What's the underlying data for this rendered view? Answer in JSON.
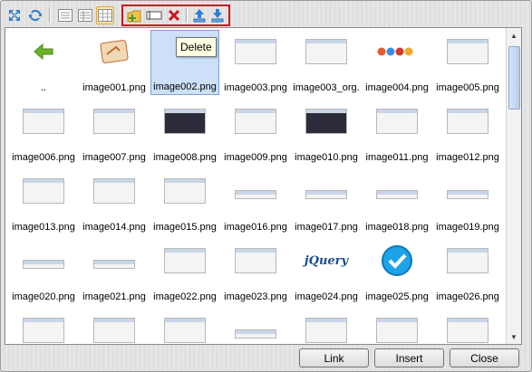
{
  "tooltip": "Delete",
  "buttons": {
    "link": "Link",
    "insert": "Insert",
    "close": "Close"
  },
  "toolbar": {
    "tools": [
      {
        "name": "expand-icon"
      },
      {
        "name": "refresh-icon"
      },
      {
        "name": "view-list-icon"
      },
      {
        "name": "view-details-icon"
      },
      {
        "name": "view-thumbnails-icon",
        "active": true
      },
      {
        "name": "new-folder-icon"
      },
      {
        "name": "rename-icon"
      },
      {
        "name": "delete-icon"
      },
      {
        "name": "upload-icon"
      },
      {
        "name": "download-icon"
      }
    ]
  },
  "files": [
    {
      "label": "..",
      "kind": "up"
    },
    {
      "label": "image001.png",
      "kind": "app"
    },
    {
      "label": "image002.png",
      "kind": "blank",
      "selected": true
    },
    {
      "label": "image003.png",
      "kind": "shot"
    },
    {
      "label": "image003_org.",
      "kind": "shot"
    },
    {
      "label": "image004.png",
      "kind": "browsers"
    },
    {
      "label": "image005.png",
      "kind": "shot"
    },
    {
      "label": "image006.png",
      "kind": "shot"
    },
    {
      "label": "image007.png",
      "kind": "shot"
    },
    {
      "label": "image008.png",
      "kind": "dark"
    },
    {
      "label": "image009.png",
      "kind": "shot"
    },
    {
      "label": "image010.png",
      "kind": "dark"
    },
    {
      "label": "image011.png",
      "kind": "shot"
    },
    {
      "label": "image012.png",
      "kind": "shot"
    },
    {
      "label": "image013.png",
      "kind": "shot"
    },
    {
      "label": "image014.png",
      "kind": "shot"
    },
    {
      "label": "image015.png",
      "kind": "shot"
    },
    {
      "label": "image016.png",
      "kind": "thin"
    },
    {
      "label": "image017.png",
      "kind": "thin"
    },
    {
      "label": "image018.png",
      "kind": "thin"
    },
    {
      "label": "image019.png",
      "kind": "thin"
    },
    {
      "label": "image020.png",
      "kind": "thin"
    },
    {
      "label": "image021.png",
      "kind": "thin"
    },
    {
      "label": "image022.png",
      "kind": "shot"
    },
    {
      "label": "image023.png",
      "kind": "shot"
    },
    {
      "label": "image024.png",
      "kind": "jquery",
      "logo_text": "jQuery"
    },
    {
      "label": "image025.png",
      "kind": "check"
    },
    {
      "label": "image026.png",
      "kind": "shot"
    },
    {
      "label": "",
      "kind": "shot"
    },
    {
      "label": "",
      "kind": "shot"
    },
    {
      "label": "",
      "kind": "shot"
    },
    {
      "label": "",
      "kind": "thin"
    },
    {
      "label": "",
      "kind": "shot"
    },
    {
      "label": "",
      "kind": "shot"
    },
    {
      "label": "",
      "kind": "shot"
    }
  ]
}
